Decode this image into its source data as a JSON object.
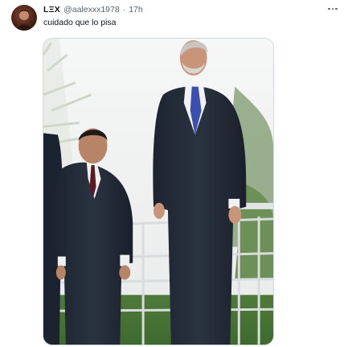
{
  "post": {
    "author": {
      "display_name": "LΞX",
      "handle": "@aalexxx1978",
      "separator": "·",
      "timestamp": "17h"
    },
    "text": "cuidado que lo pisa",
    "media": {
      "alt_label": ""
    }
  },
  "colors": {
    "text_primary": "#0f1419",
    "text_secondary": "#536471",
    "media_border": "#cfd9de"
  },
  "icons": {
    "more": "more-horizontal-icon",
    "avatar": "profile-avatar-photo"
  }
}
